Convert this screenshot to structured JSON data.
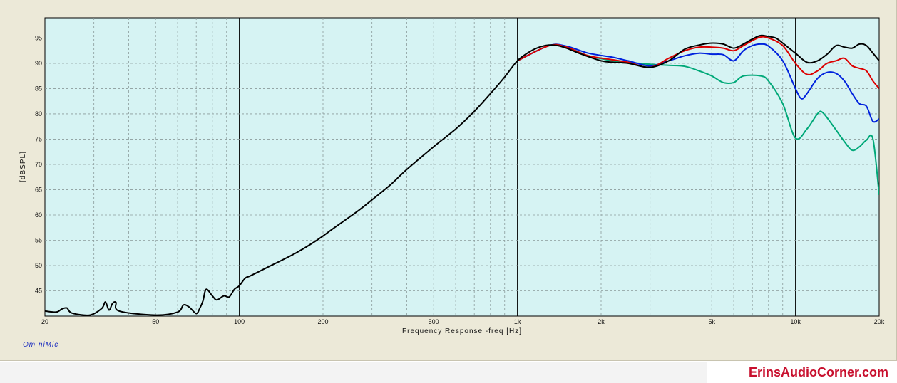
{
  "chart_data": {
    "type": "line",
    "xscale": "log",
    "xlim": [
      20,
      20000
    ],
    "ylim": [
      40,
      99
    ],
    "xlabel": "Frequency Response -freq [Hz]",
    "ylabel": "[dBSPL]",
    "grid": true,
    "xticks": [
      {
        "v": 20,
        "label": "20"
      },
      {
        "v": 50,
        "label": "50"
      },
      {
        "v": 100,
        "label": "100"
      },
      {
        "v": 200,
        "label": "200"
      },
      {
        "v": 500,
        "label": "500"
      },
      {
        "v": 1000,
        "label": "1k"
      },
      {
        "v": 2000,
        "label": "2k"
      },
      {
        "v": 5000,
        "label": "5k"
      },
      {
        "v": 10000,
        "label": "10k"
      },
      {
        "v": 20000,
        "label": "20k"
      }
    ],
    "yticks": [
      45,
      50,
      55,
      60,
      65,
      70,
      75,
      80,
      85,
      90,
      95
    ],
    "series": [
      {
        "color": "#00a878",
        "points": [
          [
            1000,
            90.5
          ],
          [
            1300,
            93.5
          ],
          [
            1500,
            93.2
          ],
          [
            1800,
            91.5
          ],
          [
            2200,
            90.5
          ],
          [
            2500,
            90.2
          ],
          [
            3000,
            89.8
          ],
          [
            3500,
            89.6
          ],
          [
            4000,
            89.4
          ],
          [
            4500,
            88.5
          ],
          [
            5000,
            87.5
          ],
          [
            5500,
            86.2
          ],
          [
            6000,
            86.2
          ],
          [
            6500,
            87.5
          ],
          [
            7500,
            87.5
          ],
          [
            8000,
            86.5
          ],
          [
            9000,
            82
          ],
          [
            10000,
            75.2
          ],
          [
            11000,
            77
          ],
          [
            12000,
            80
          ],
          [
            12500,
            80.3
          ],
          [
            13500,
            78
          ],
          [
            15000,
            74.5
          ],
          [
            16000,
            72.8
          ],
          [
            17000,
            73.5
          ],
          [
            18000,
            74.8
          ],
          [
            19000,
            75
          ],
          [
            20000,
            64
          ]
        ]
      },
      {
        "color": "#0022dd",
        "points": [
          [
            1000,
            90.5
          ],
          [
            1300,
            93.5
          ],
          [
            1500,
            93.4
          ],
          [
            1800,
            92
          ],
          [
            2200,
            91.2
          ],
          [
            2500,
            90.5
          ],
          [
            3000,
            89.5
          ],
          [
            3500,
            90.5
          ],
          [
            4000,
            91.5
          ],
          [
            4500,
            92
          ],
          [
            5000,
            91.8
          ],
          [
            5500,
            91.7
          ],
          [
            6000,
            90.5
          ],
          [
            6500,
            92.5
          ],
          [
            7000,
            93.5
          ],
          [
            7500,
            93.8
          ],
          [
            8000,
            93.4
          ],
          [
            9000,
            90.5
          ],
          [
            10000,
            85
          ],
          [
            10500,
            83
          ],
          [
            11000,
            84
          ],
          [
            12000,
            87
          ],
          [
            13000,
            88.2
          ],
          [
            14000,
            88
          ],
          [
            15000,
            86.5
          ],
          [
            16000,
            84
          ],
          [
            17000,
            82
          ],
          [
            18000,
            81.5
          ],
          [
            19000,
            78.5
          ],
          [
            20000,
            79
          ]
        ]
      },
      {
        "color": "#dd0000",
        "points": [
          [
            1000,
            90.5
          ],
          [
            1300,
            93.5
          ],
          [
            1500,
            93.2
          ],
          [
            1800,
            91.5
          ],
          [
            2200,
            90.7
          ],
          [
            2500,
            90.2
          ],
          [
            3000,
            89.2
          ],
          [
            3500,
            91
          ],
          [
            4000,
            92.5
          ],
          [
            4500,
            93.2
          ],
          [
            5000,
            93.2
          ],
          [
            5500,
            93
          ],
          [
            6000,
            92.5
          ],
          [
            6500,
            93.5
          ],
          [
            7000,
            94.5
          ],
          [
            7500,
            95.2
          ],
          [
            8000,
            95
          ],
          [
            9000,
            93.5
          ],
          [
            10000,
            90
          ],
          [
            11000,
            87.8
          ],
          [
            12000,
            88.5
          ],
          [
            13000,
            90
          ],
          [
            14000,
            90.5
          ],
          [
            15000,
            91
          ],
          [
            16000,
            89.5
          ],
          [
            17000,
            89
          ],
          [
            18000,
            88.5
          ],
          [
            19000,
            86.5
          ],
          [
            20000,
            85
          ]
        ]
      },
      {
        "color": "#000000",
        "points": [
          [
            20,
            41
          ],
          [
            22,
            40.8
          ],
          [
            23,
            41.4
          ],
          [
            24,
            41.6
          ],
          [
            25,
            40.6
          ],
          [
            29,
            40.2
          ],
          [
            32,
            41.5
          ],
          [
            33,
            42.8
          ],
          [
            34,
            41.2
          ],
          [
            35,
            42.5
          ],
          [
            36,
            42.7
          ],
          [
            37,
            41
          ],
          [
            50,
            40.2
          ],
          [
            60,
            40.8
          ],
          [
            63,
            42.2
          ],
          [
            66,
            41.8
          ],
          [
            70,
            40.5
          ],
          [
            72,
            41.5
          ],
          [
            74,
            43
          ],
          [
            76,
            45.3
          ],
          [
            80,
            44
          ],
          [
            83,
            43.2
          ],
          [
            88,
            44
          ],
          [
            92,
            43.8
          ],
          [
            96,
            45.3
          ],
          [
            100,
            46
          ],
          [
            105,
            47.5
          ],
          [
            110,
            48
          ],
          [
            130,
            50
          ],
          [
            160,
            52.5
          ],
          [
            190,
            55
          ],
          [
            220,
            57.5
          ],
          [
            270,
            61
          ],
          [
            300,
            63
          ],
          [
            350,
            66
          ],
          [
            400,
            69
          ],
          [
            500,
            73.5
          ],
          [
            600,
            77
          ],
          [
            700,
            80.5
          ],
          [
            800,
            84
          ],
          [
            900,
            87.3
          ],
          [
            1000,
            90.5
          ],
          [
            1100,
            92.2
          ],
          [
            1200,
            93.2
          ],
          [
            1300,
            93.6
          ],
          [
            1400,
            93.5
          ],
          [
            1500,
            93
          ],
          [
            1700,
            91.8
          ],
          [
            2000,
            90.5
          ],
          [
            2200,
            90.2
          ],
          [
            2500,
            90
          ],
          [
            3000,
            89.2
          ],
          [
            3500,
            90.5
          ],
          [
            4000,
            92.8
          ],
          [
            4500,
            93.6
          ],
          [
            5000,
            94
          ],
          [
            5500,
            93.8
          ],
          [
            6000,
            93
          ],
          [
            6500,
            93.8
          ],
          [
            7000,
            94.8
          ],
          [
            7500,
            95.5
          ],
          [
            8000,
            95.3
          ],
          [
            8500,
            95
          ],
          [
            9000,
            94
          ],
          [
            10000,
            92
          ],
          [
            11000,
            90.2
          ],
          [
            12000,
            90.5
          ],
          [
            13000,
            91.8
          ],
          [
            14000,
            93.5
          ],
          [
            15000,
            93.2
          ],
          [
            16000,
            93
          ],
          [
            17000,
            93.8
          ],
          [
            18000,
            93.5
          ],
          [
            19000,
            92
          ],
          [
            20000,
            90.5
          ]
        ]
      }
    ]
  },
  "footer": {
    "software": "Om niMic",
    "watermark": "ErinsAudioCorner.com"
  }
}
